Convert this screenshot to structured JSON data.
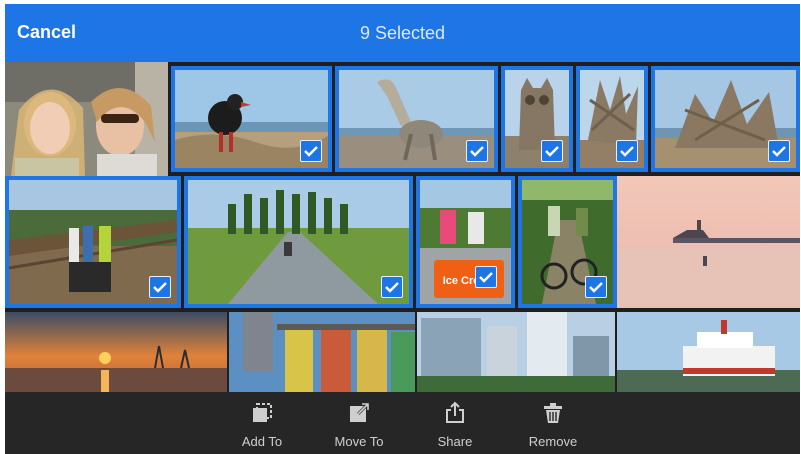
{
  "header": {
    "cancel_label": "Cancel",
    "selection_title": "9 Selected"
  },
  "colors": {
    "accent": "#1e75e6",
    "toolbar_bg": "#262626"
  },
  "photos": [
    {
      "id": "portrait-two-women",
      "selected": false
    },
    {
      "id": "driftwood-bird-dark",
      "selected": true
    },
    {
      "id": "driftwood-heron",
      "selected": true
    },
    {
      "id": "driftwood-owl",
      "selected": true
    },
    {
      "id": "driftwood-tangle",
      "selected": true
    },
    {
      "id": "driftwood-sculpture",
      "selected": true
    },
    {
      "id": "cyclists-boardwalk",
      "selected": true
    },
    {
      "id": "cyclist-poplar-road",
      "selected": true
    },
    {
      "id": "ice-cream-cyclists",
      "selected": true
    },
    {
      "id": "cyclists-forest-path",
      "selected": true
    },
    {
      "id": "pier-sunset-pink",
      "selected": false
    },
    {
      "id": "harbor-sunset",
      "selected": false
    },
    {
      "id": "painted-silos",
      "selected": false
    },
    {
      "id": "city-towers",
      "selected": false
    },
    {
      "id": "paddle-wheeler",
      "selected": false
    }
  ],
  "photo_text": {
    "ice_cream_sign": "Ice Cream"
  },
  "toolbar": {
    "items": [
      {
        "label": "Add To",
        "icon": "add-to-album-icon"
      },
      {
        "label": "Move To",
        "icon": "move-to-icon"
      },
      {
        "label": "Share",
        "icon": "share-icon"
      },
      {
        "label": "Remove",
        "icon": "trash-icon"
      }
    ]
  }
}
